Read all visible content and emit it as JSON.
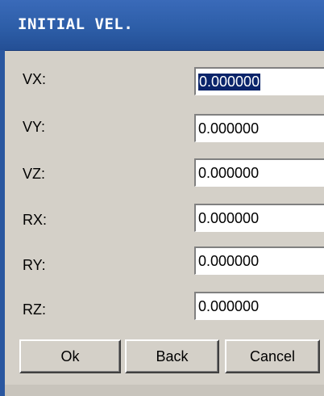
{
  "dialog": {
    "title": "INITIAL VEL.",
    "fields": [
      {
        "label": "VX:",
        "value": "0.000000",
        "selected": true
      },
      {
        "label": "VY:",
        "value": "0.000000"
      },
      {
        "label": "VZ:",
        "value": "0.000000"
      },
      {
        "label": "RX:",
        "value": "0.000000"
      },
      {
        "label": "RY:",
        "value": "0.000000"
      },
      {
        "label": "RZ:",
        "value": "0.000000"
      }
    ],
    "buttons": {
      "ok": "Ok",
      "back": "Back",
      "cancel": "Cancel"
    }
  },
  "colors": {
    "titlebar": "#2d5ea8",
    "title_text": "#ffffff",
    "panel": "#d4d0c8",
    "selection": "#0a246a"
  }
}
